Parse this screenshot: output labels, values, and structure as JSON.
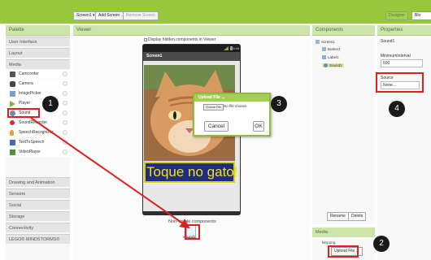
{
  "toolbar": {
    "screen_select": "Screen1 ▾",
    "add_screen": "Add Screen ...",
    "remove_screen": "Remove Screen",
    "designer": "Designer",
    "blocks": "Blo"
  },
  "palette": {
    "header": "Palette",
    "categories_top": [
      "User Interface",
      "Layout",
      "Media"
    ],
    "media_items": [
      {
        "label": "Camcorder",
        "icon": "camcorder-icon"
      },
      {
        "label": "Camera",
        "icon": "camera-icon"
      },
      {
        "label": "ImagePicker",
        "icon": "image-picker-icon"
      },
      {
        "label": "Player",
        "icon": "player-icon"
      },
      {
        "label": "Sound",
        "icon": "sound-icon"
      },
      {
        "label": "SoundRecorder",
        "icon": "sound-recorder-icon"
      },
      {
        "label": "SpeechRecognizer",
        "icon": "speech-recognizer-icon"
      },
      {
        "label": "TextToSpeech",
        "icon": "text-to-speech-icon"
      },
      {
        "label": "VideoPlayer",
        "icon": "video-player-icon"
      }
    ],
    "categories_bottom": [
      "Drawing and Animation",
      "Sensors",
      "Social",
      "Storage",
      "Connectivity",
      "LEGO® MINDSTORMS®"
    ]
  },
  "viewer": {
    "header": "Viewer",
    "display_hidden": "Display hidden components in Viewer",
    "status_time": "9:48",
    "screen_title": "Screen1",
    "label_text": "Toque no gato!",
    "nonvisible_label": "Non-visible components",
    "nonvisible_item": "Sound1"
  },
  "dialog": {
    "title": "Upload File ...",
    "choose_file": "Choose File",
    "no_file": "No file chosen",
    "cancel": "Cancel",
    "ok": "OK"
  },
  "components": {
    "header": "Components",
    "tree": [
      "Screen1",
      "Button1",
      "Label1",
      "Sound1"
    ],
    "rename": "Rename",
    "delete": "Delete"
  },
  "media": {
    "header": "Media",
    "line": "kitty.png",
    "upload": "Upload File ..."
  },
  "properties": {
    "header": "Properties",
    "component": "Sound1",
    "min_interval_label": "MinimumInterval",
    "min_interval_value": "500",
    "source_label": "Source",
    "source_value": "None..."
  },
  "annotations": [
    "1",
    "2",
    "3",
    "4"
  ],
  "colors": {
    "accent": "#97c83c",
    "highlight": "#e02020",
    "badge": "#1a1a1a"
  }
}
